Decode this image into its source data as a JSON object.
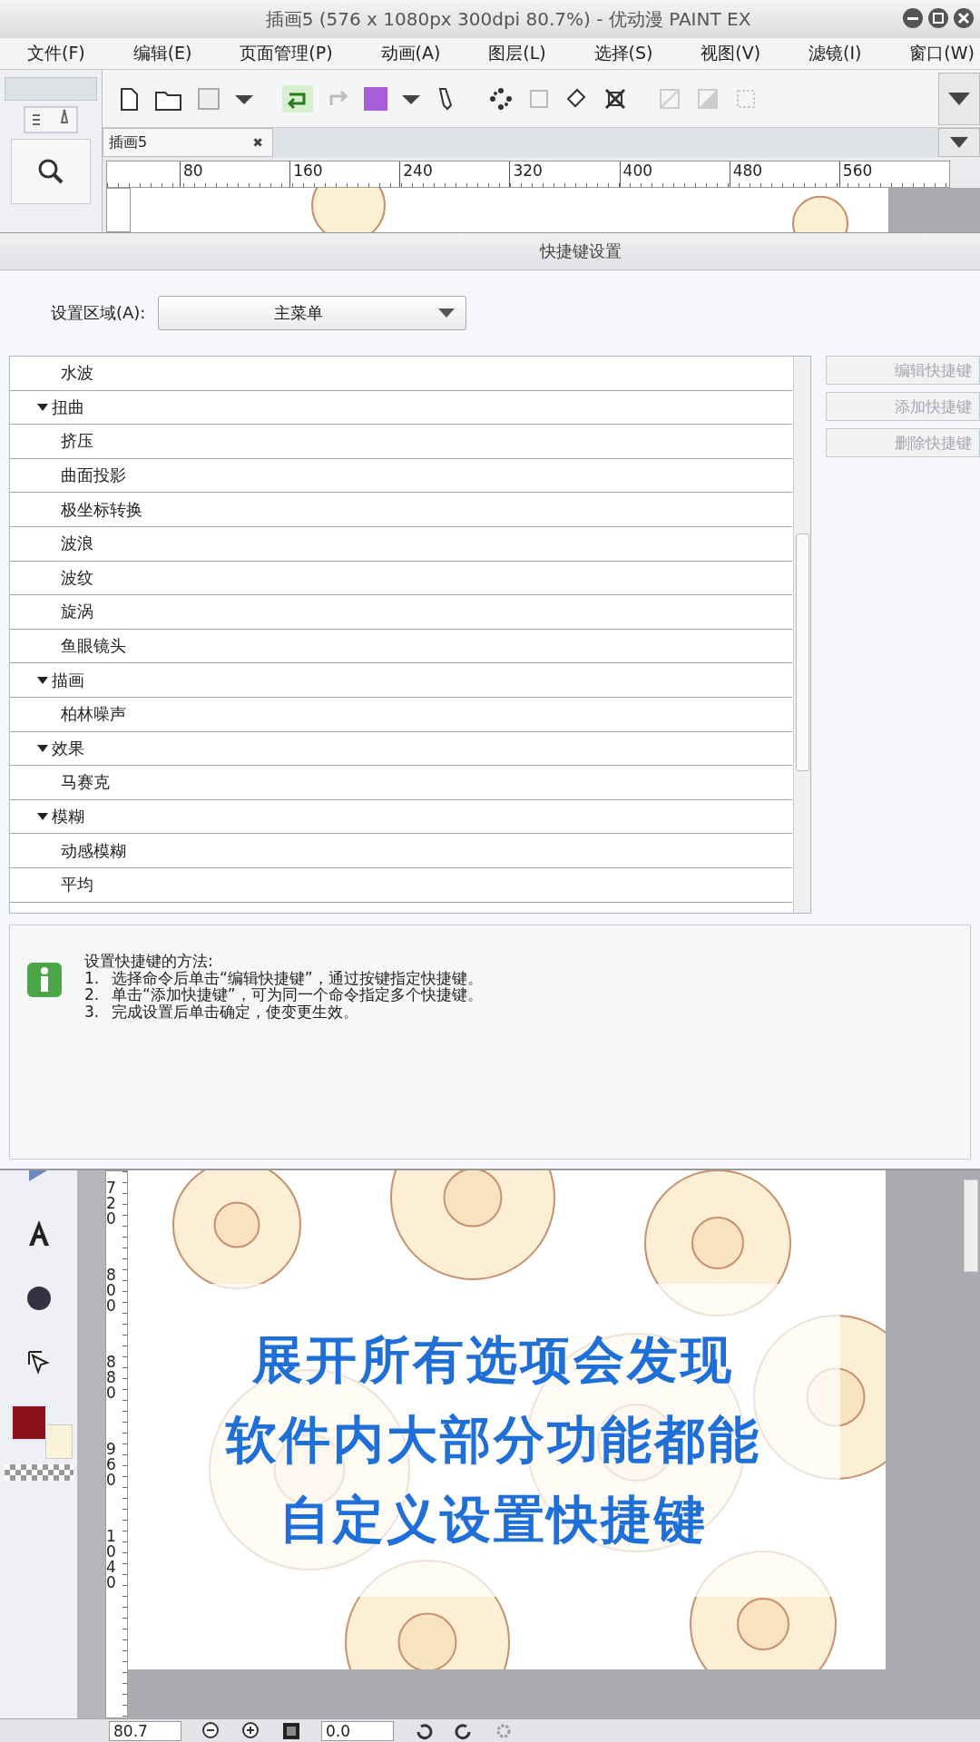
{
  "window": {
    "title": "插画5 (576 x 1080px 300dpi 80.7%)  - 优动漫 PAINT EX"
  },
  "menu": [
    "文件(F)",
    "编辑(E)",
    "页面管理(P)",
    "动画(A)",
    "图层(L)",
    "选择(S)",
    "视图(V)",
    "滤镜(I)",
    "窗口(W)"
  ],
  "doc_tab": {
    "label": "插画5",
    "close": "✖"
  },
  "top_ruler": [
    "80",
    "160",
    "240",
    "320",
    "400",
    "480",
    "560"
  ],
  "dialog": {
    "title": "快捷键设置",
    "area_label": "设置区域(A):",
    "area_value": "主菜单",
    "tree": [
      {
        "children": [
          {
            "label": "水波"
          }
        ]
      },
      {
        "label": "扭曲",
        "expanded": true,
        "children": [
          {
            "label": "挤压"
          },
          {
            "label": "曲面投影"
          },
          {
            "label": "极坐标转换"
          },
          {
            "label": "波浪"
          },
          {
            "label": "波纹"
          },
          {
            "label": "旋涡"
          },
          {
            "label": "鱼眼镜头"
          }
        ]
      },
      {
        "label": "描画",
        "expanded": true,
        "children": [
          {
            "label": "柏林噪声"
          }
        ]
      },
      {
        "label": "效果",
        "expanded": true,
        "children": [
          {
            "label": "马赛克"
          }
        ]
      },
      {
        "label": "模糊",
        "expanded": true,
        "children": [
          {
            "label": "动感模糊"
          },
          {
            "label": "平均"
          }
        ]
      }
    ],
    "buttons": [
      {
        "label": "编辑快捷键",
        "disabled": true
      },
      {
        "label": "添加快捷键",
        "disabled": true
      },
      {
        "label": "删除快捷键",
        "disabled": true
      }
    ],
    "info_heading": "设置快捷键的方法:",
    "info_steps": [
      {
        "number": "1.",
        "text": "选择命令后单击“编辑快捷键”，通过按键指定快捷键。"
      },
      {
        "number": "2.",
        "text": "单击“添加快捷键”，可为同一个命令指定多个快捷键。"
      },
      {
        "number": "3.",
        "text": "完成设置后单击确定，使变更生效。"
      }
    ]
  },
  "left_ruler": [
    "720",
    "800",
    "880",
    "960",
    "1040"
  ],
  "status": {
    "zoom": "80.7",
    "rotation": "0.0"
  },
  "caption": [
    "展开所有选项会发现",
    "软件内大部分功能都能",
    "自定义设置快捷键"
  ]
}
